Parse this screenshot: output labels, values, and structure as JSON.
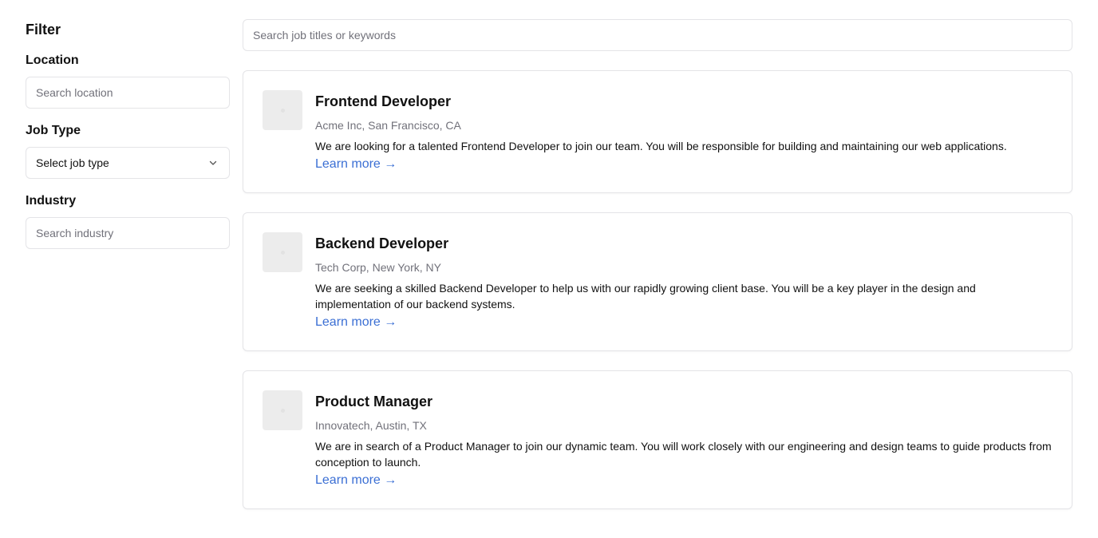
{
  "sidebar": {
    "title": "Filter",
    "location": {
      "label": "Location",
      "placeholder": "Search location"
    },
    "job_type": {
      "label": "Job Type",
      "selected": "Select job type"
    },
    "industry": {
      "label": "Industry",
      "placeholder": "Search industry"
    }
  },
  "search": {
    "placeholder": "Search job titles or keywords"
  },
  "jobs": [
    {
      "title": "Frontend Developer",
      "meta": "Acme Inc, San Francisco, CA",
      "description": "We are looking for a talented Frontend Developer to join our team. You will be responsible for building and maintaining our web applications.",
      "link": "Learn more →"
    },
    {
      "title": "Backend Developer",
      "meta": "Tech Corp, New York, NY",
      "description": "We are seeking a skilled Backend Developer to help us with our rapidly growing client base. You will be a key player in the design and implementation of our backend systems.",
      "link": "Learn more →"
    },
    {
      "title": "Product Manager",
      "meta": "Innovatech, Austin, TX",
      "description": "We are in search of a Product Manager to join our dynamic team. You will work closely with our engineering and design teams to guide products from conception to launch.",
      "link": "Learn more →"
    }
  ],
  "icons": {
    "chevron": "chevron-down-icon",
    "logo": "company-logo-placeholder"
  },
  "colors": {
    "link": "#3b6fd4",
    "muted_text": "#71717a",
    "border": "#e4e4e7",
    "logo_placeholder": "#ececec"
  }
}
